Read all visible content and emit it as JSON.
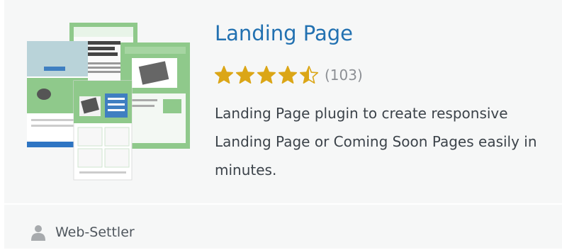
{
  "plugin": {
    "title": "Landing Page",
    "rating": 4.5,
    "rating_max": 5,
    "rating_count": "(103)",
    "description": "Landing Page plugin to create responsive Landing Page or Coming Soon Pages easily in minutes.",
    "author": "Web-Settler"
  },
  "colors": {
    "title": "#2271b1",
    "star": "#dba617",
    "card_bg": "#f6f7f7",
    "text": "#3c434a",
    "muted": "#8c8f94",
    "thumb_green": "#8fc98b"
  },
  "icons": {
    "author": "person-icon",
    "star_full": "star-filled-icon",
    "star_half": "star-half-icon",
    "star_empty": "star-empty-icon"
  }
}
